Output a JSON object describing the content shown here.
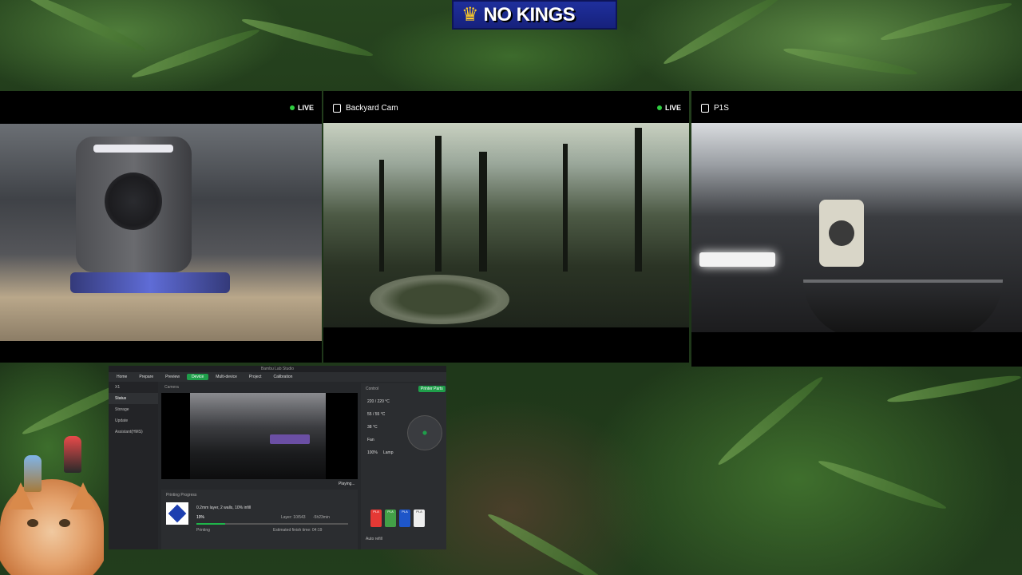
{
  "overlay": {
    "logo_text": "NO KINGS",
    "logo_icon": "crown-icon"
  },
  "cameras": [
    {
      "title": "",
      "live": "LIVE"
    },
    {
      "title": "Backyard Cam",
      "live": "LIVE"
    },
    {
      "title": "P1S",
      "live": ""
    }
  ],
  "studio": {
    "window_title": "Bambu Lab Studio",
    "tabs": [
      "Home",
      "Prepare",
      "Preview",
      "Device",
      "Multi-device",
      "Project",
      "Calibration"
    ],
    "active_tab": "Device",
    "printer_name": "X1",
    "sidebar": [
      "Status",
      "Storage",
      "Update",
      "Assistant(HMS)"
    ],
    "camera_label": "Camera",
    "playing": "Playing...",
    "progress_header": "Printing Progress",
    "job_desc": "0.2mm layer, 2 walls, 10% infill",
    "percent": "19%",
    "progress": 0.19,
    "state": "Printing",
    "layer": "Layer: 10/543",
    "time_left": "-5h23min",
    "finish_time": "Estimated finish time: 04:19",
    "control_label": "Control",
    "printer_parts": "Printer Parts",
    "temps": [
      "220 / 220 °C",
      "55 / 55 °C",
      "38 °C"
    ],
    "fan_label": "Fan",
    "speed": "100%",
    "lamp": "Lamp",
    "auto_refill": "Auto refill",
    "spools": [
      {
        "label": "PLA",
        "color": "#e53935"
      },
      {
        "label": "PLA",
        "color": "#43a047"
      },
      {
        "label": "PLA",
        "color": "#1e56c9"
      },
      {
        "label": "PLA",
        "color": "#eeeeee"
      }
    ]
  }
}
